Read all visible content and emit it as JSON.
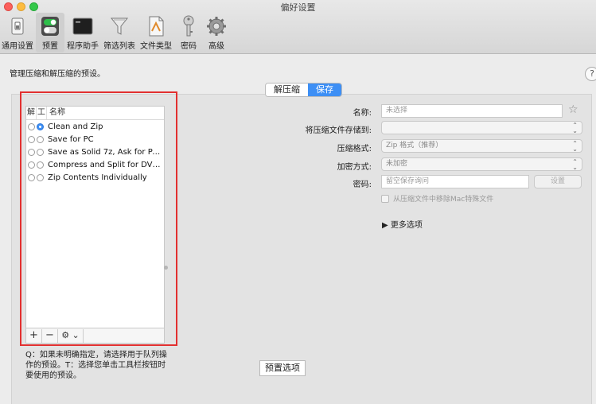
{
  "window": {
    "title": "偏好设置"
  },
  "toolbar": {
    "items": [
      {
        "label": "通用设置",
        "icon": "switch-icon"
      },
      {
        "label": "预置",
        "icon": "toggle-icon",
        "selected": true
      },
      {
        "label": "程序助手",
        "icon": "terminal-icon"
      },
      {
        "label": "筛选列表",
        "icon": "funnel-icon"
      },
      {
        "label": "文件类型",
        "icon": "document-icon"
      },
      {
        "label": "密码",
        "icon": "key-icon"
      },
      {
        "label": "高级",
        "icon": "gear-icon"
      }
    ]
  },
  "main": {
    "description": "管理压缩和解压缩的预设。",
    "help": "?",
    "tabs": [
      {
        "label": "解压缩",
        "active": false
      },
      {
        "label": "保存",
        "active": true
      }
    ]
  },
  "preset_list": {
    "col_a": "解",
    "col_b": "工",
    "col_name": "名称",
    "items": [
      {
        "name": "Clean and Zip",
        "a": false,
        "b": true
      },
      {
        "name": "Save for PC",
        "a": false,
        "b": false
      },
      {
        "name": "Save as Solid 7z, Ask for Pass...",
        "a": false,
        "b": false
      },
      {
        "name": "Compress and Split for DVD (...",
        "a": false,
        "b": false
      },
      {
        "name": "Zip Contents Individually",
        "a": false,
        "b": false
      }
    ],
    "add": "+",
    "remove": "−",
    "action": "⚙ ⌄"
  },
  "note": "Q：如果未明确指定，请选择用于队列操作的预设。T：选择您单击工具栏按钮时要使用的预设。",
  "preset_options_button": "预置选项",
  "form": {
    "name_label": "名称:",
    "name_placeholder": "未选择",
    "save_to_label": "将压缩文件存储到:",
    "save_to_value": "",
    "format_label": "压缩格式:",
    "format_value": "Zip 格式（推荐）",
    "encryption_label": "加密方式:",
    "encryption_value": "未加密",
    "password_label": "密码:",
    "password_placeholder": "留空保存询问",
    "set_button": "设置",
    "remove_mac_files": "从压缩文件中移除Mac特殊文件",
    "more_options": "▶ 更多选项"
  },
  "colors": {
    "accent": "#3d8ff5",
    "highlight_frame": "#e23030"
  }
}
